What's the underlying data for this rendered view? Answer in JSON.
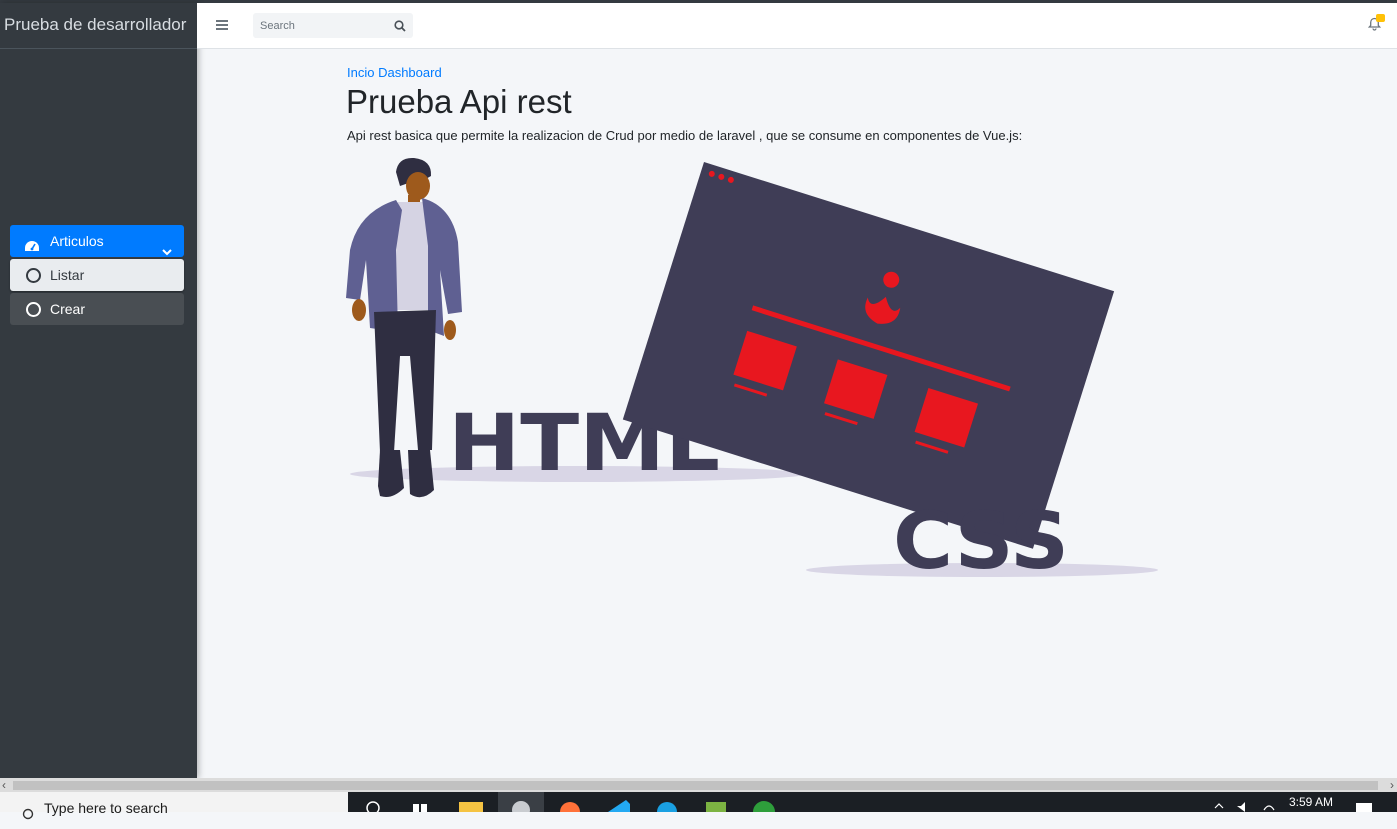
{
  "app": {
    "brand": "Prueba de desarrollador"
  },
  "header": {
    "search_placeholder": "Search",
    "notification_count": ""
  },
  "sidebar": {
    "items": [
      {
        "label": "Articulos",
        "children": [
          {
            "label": "Listar"
          },
          {
            "label": "Crear"
          }
        ]
      }
    ]
  },
  "main": {
    "breadcrumb": "Incio Dashboard",
    "title": "Prueba Api rest",
    "description": "Api rest basica que permite la realizacion de Crud por medio de laravel , que se consume en componentes de Vue.js:"
  },
  "illustration": {
    "html_text": "HTML",
    "css_text": "CSS"
  },
  "taskbar": {
    "search_placeholder": "Type here to search",
    "time": "3:59 AM"
  },
  "colors": {
    "sidebar_bg": "#343a40",
    "accent": "#007bff",
    "illustration_dark": "#3f3d56",
    "illustration_red": "#e8171f"
  },
  "icons": [
    "hamburger-icon",
    "search-icon",
    "bell-icon",
    "dashboard-icon",
    "chevron-down-icon",
    "circle-icon"
  ]
}
